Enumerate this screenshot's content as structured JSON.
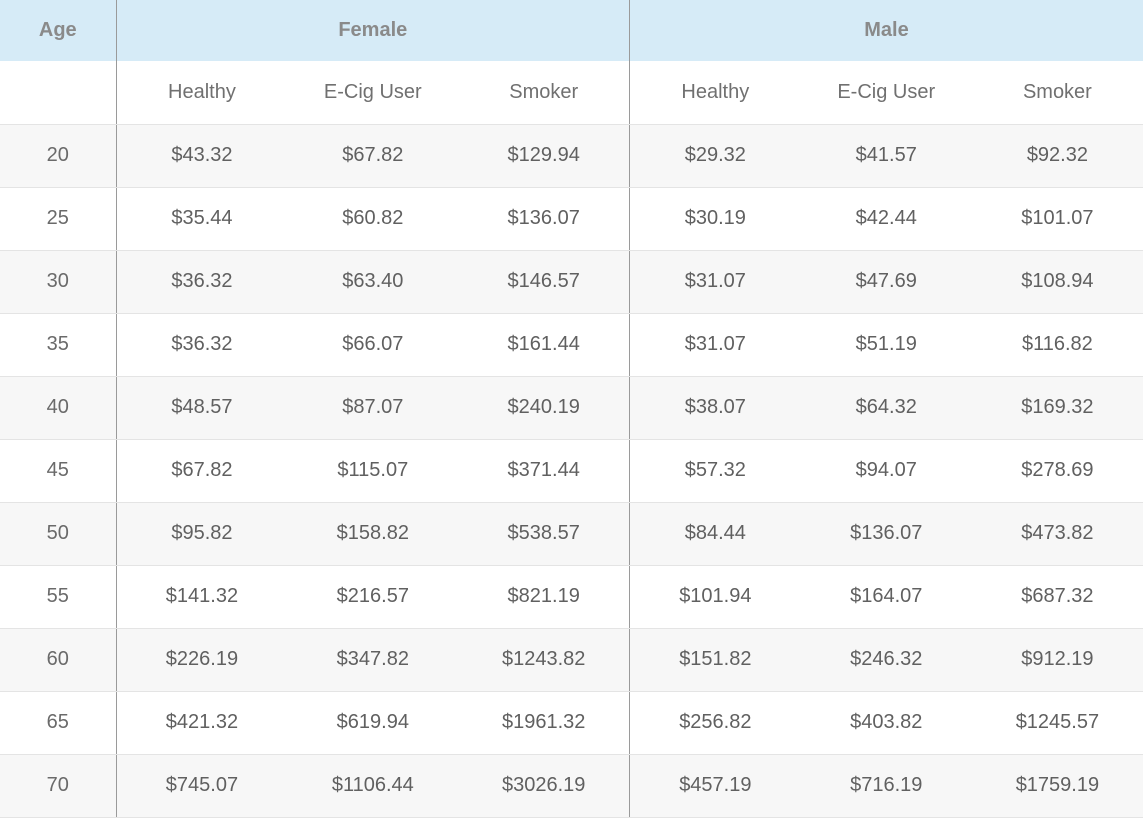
{
  "chart_data": {
    "type": "table",
    "header": {
      "age": "Age",
      "groups": [
        "Female",
        "Male"
      ],
      "subcolumns": [
        "Healthy",
        "E-Cig User",
        "Smoker",
        "Healthy",
        "E-Cig User",
        "Smoker"
      ]
    },
    "rows": [
      {
        "age": "20",
        "values": [
          "$43.32",
          "$67.82",
          "$129.94",
          "$29.32",
          "$41.57",
          "$92.32"
        ]
      },
      {
        "age": "25",
        "values": [
          "$35.44",
          "$60.82",
          "$136.07",
          "$30.19",
          "$42.44",
          "$101.07"
        ]
      },
      {
        "age": "30",
        "values": [
          "$36.32",
          "$63.40",
          "$146.57",
          "$31.07",
          "$47.69",
          "$108.94"
        ]
      },
      {
        "age": "35",
        "values": [
          "$36.32",
          "$66.07",
          "$161.44",
          "$31.07",
          "$51.19",
          "$116.82"
        ]
      },
      {
        "age": "40",
        "values": [
          "$48.57",
          "$87.07",
          "$240.19",
          "$38.07",
          "$64.32",
          "$169.32"
        ]
      },
      {
        "age": "45",
        "values": [
          "$67.82",
          "$115.07",
          "$371.44",
          "$57.32",
          "$94.07",
          "$278.69"
        ]
      },
      {
        "age": "50",
        "values": [
          "$95.82",
          "$158.82",
          "$538.57",
          "$84.44",
          "$136.07",
          "$473.82"
        ]
      },
      {
        "age": "55",
        "values": [
          "$141.32",
          "$216.57",
          "$821.19",
          "$101.94",
          "$164.07",
          "$687.32"
        ]
      },
      {
        "age": "60",
        "values": [
          "$226.19",
          "$347.82",
          "$1243.82",
          "$151.82",
          "$246.32",
          "$912.19"
        ]
      },
      {
        "age": "65",
        "values": [
          "$421.32",
          "$619.94",
          "$1961.32",
          "$256.82",
          "$403.82",
          "$1245.57"
        ]
      },
      {
        "age": "70",
        "values": [
          "$745.07",
          "$1106.44",
          "$3026.19",
          "$457.19",
          "$716.19",
          "$1759.19"
        ]
      }
    ],
    "colors": {
      "header_background": "#d6ebf7",
      "row_stripe": "#f7f7f7",
      "divider": "#9a9a9a"
    }
  }
}
